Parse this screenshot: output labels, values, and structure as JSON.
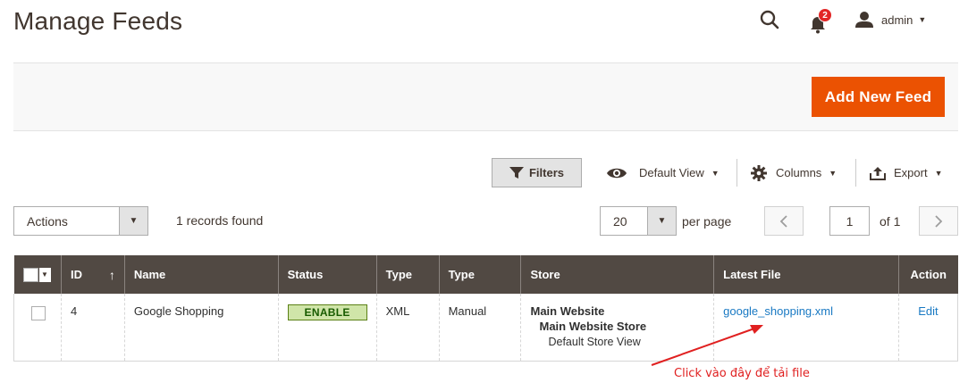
{
  "header": {
    "title": "Manage Feeds",
    "notifications_count": "2",
    "user_name": "admin"
  },
  "action_bar": {
    "add_new_label": "Add New Feed"
  },
  "toolbar": {
    "filters_label": "Filters",
    "view_label": "Default View",
    "columns_label": "Columns",
    "export_label": "Export"
  },
  "mass_actions": {
    "actions_label": "Actions",
    "records_found": "1 records found"
  },
  "pager": {
    "per_page_value": "20",
    "per_page_label": "per page",
    "current_page": "1",
    "of_pages": "of 1"
  },
  "grid": {
    "columns": [
      "ID",
      "Name",
      "Status",
      "Type",
      "Type",
      "Store",
      "Latest File",
      "Action"
    ],
    "rows": [
      {
        "id": "4",
        "name": "Google Shopping",
        "status": "ENABLE",
        "type": "XML",
        "execution_type": "Manual",
        "store_website": "Main Website",
        "store_group": "Main Website Store",
        "store_view": "Default Store View",
        "latest_file": "google_shopping.xml",
        "action": "Edit"
      }
    ]
  },
  "annotation": {
    "text": "Click vào đây để tải file"
  },
  "colors": {
    "accent": "#eb5202",
    "header_bg": "#514943",
    "link": "#1979c3",
    "status_bg": "#d0e5a9",
    "annotation": "#e02020"
  }
}
